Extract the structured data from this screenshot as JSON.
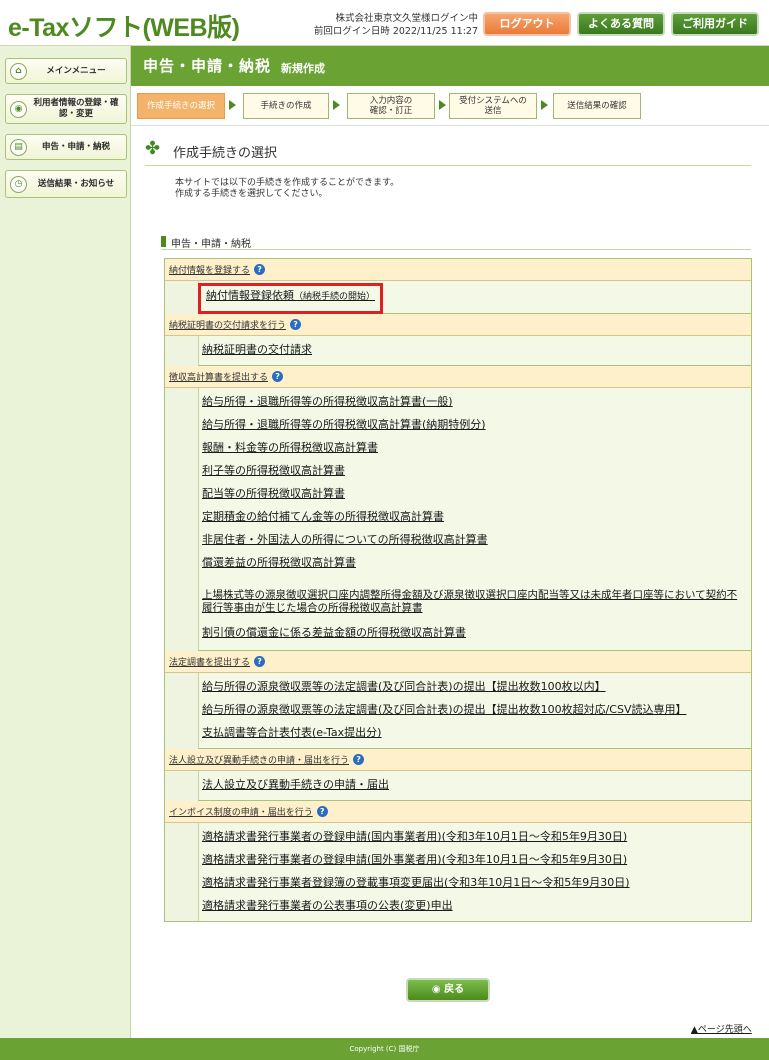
{
  "header": {
    "logo": "e-Taxソフト(WEB版)",
    "login_line1": "株式会社東京文久堂様ログイン中",
    "login_line2": "前回ログイン日時 2022/11/25 11:27",
    "logout": "ログアウト",
    "faq": "よくある質問",
    "guide": "ご利用ガイド"
  },
  "sidebar": {
    "items": [
      {
        "label": "メインメニュー",
        "icon": "home-icon"
      },
      {
        "label": "利用者情報の登録・確認・変更",
        "icon": "user-icon"
      },
      {
        "label": "申告・申請・納税",
        "icon": "document-icon"
      },
      {
        "label": "送信結果・お知らせ",
        "icon": "clock-icon"
      }
    ]
  },
  "title_bar": {
    "main": "申告・申請・納税",
    "sub": "新規作成"
  },
  "steps": [
    {
      "label": "作成手続きの選択",
      "active": true
    },
    {
      "label": "手続きの作成",
      "active": false
    },
    {
      "label": "入力内容の\n確認・訂正",
      "active": false
    },
    {
      "label": "受付システムへの\n送信",
      "active": false
    },
    {
      "label": "送信結果の確認",
      "active": false
    }
  ],
  "section": {
    "title": "作成手続きの選択",
    "intro_line1": "本サイトでは以下の手続きを作成することができます。",
    "intro_line2": "作成する手続きを選択してください。",
    "category": "申告・申請・納税"
  },
  "groups": [
    {
      "label": "納付情報を登録する",
      "items": [
        "納付情報登録依頼"
      ],
      "item_note": "（納税手続の開始）"
    },
    {
      "label": "納税証明書の交付請求を行う",
      "items": [
        "納税証明書の交付請求"
      ]
    },
    {
      "label": "徴収高計算書を提出する",
      "items": [
        "給与所得・退職所得等の所得税徴収高計算書(一般)",
        "給与所得・退職所得等の所得税徴収高計算書(納期特例分)",
        "報酬・料金等の所得税徴収高計算書",
        "利子等の所得税徴収高計算書",
        "配当等の所得税徴収高計算書",
        "定期積金の給付補てん金等の所得税徴収高計算書",
        "非居住者・外国法人の所得についての所得税徴収高計算書",
        "償還差益の所得税徴収高計算書",
        "上場株式等の源泉徴収選択口座内調整所得金額及び源泉徴収選択口座内配当等又は未成年者口座等において契約不履行等事由が生じた場合の所得税徴収高計算書",
        "割引債の償還金に係る差益金額の所得税徴収高計算書"
      ]
    },
    {
      "label": "法定調書を提出する",
      "items": [
        "給与所得の源泉徴収票等の法定調書(及び同合計表)の提出【提出枚数100枚以内】",
        "給与所得の源泉徴収票等の法定調書(及び同合計表)の提出【提出枚数100枚超対応/CSV読込専用】",
        "支払調書等合計表付表(e-Tax提出分)"
      ]
    },
    {
      "label": "法人設立及び異動手続きの申請・届出を行う",
      "items": [
        "法人設立及び異動手続きの申請・届出"
      ]
    },
    {
      "label": "インボイス制度の申請・届出を行う",
      "items": [
        "適格請求書発行事業者の登録申請(国内事業者用)(令和3年10月1日～令和5年9月30日)",
        "適格請求書発行事業者の登録申請(国外事業者用)(令和3年10月1日～令和5年9月30日)",
        "適格請求書発行事業者登録簿の登載事項変更届出(令和3年10月1日～令和5年9月30日)",
        "適格請求書発行事業者の公表事項の公表(変更)申出"
      ]
    }
  ],
  "back_button": "戻る",
  "page_top": "ページ先頭へ",
  "footer": "Copyright (C) 国税庁"
}
